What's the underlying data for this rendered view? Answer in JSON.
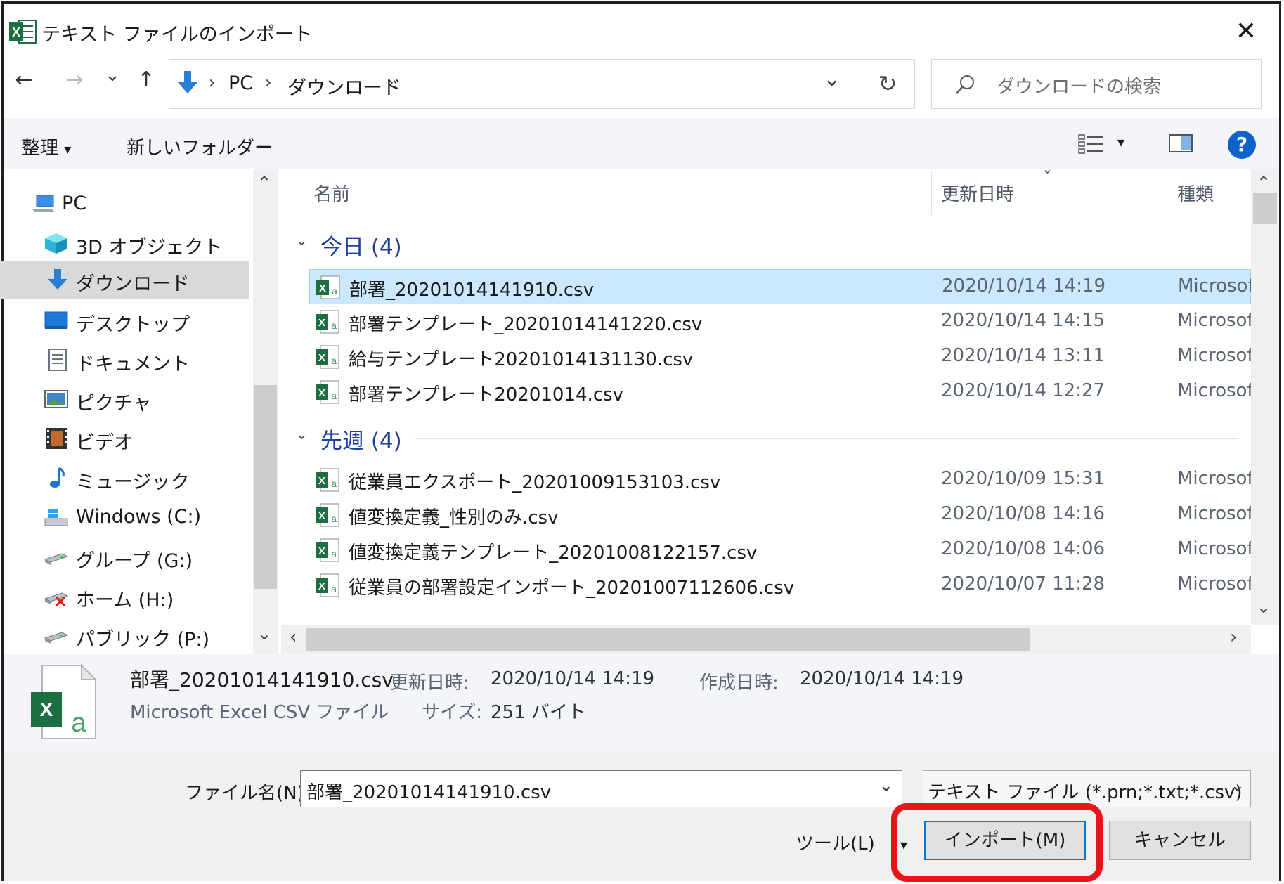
{
  "window": {
    "title": "テキスト ファイルのインポート",
    "close": "✕"
  },
  "address": {
    "back": "←",
    "forward": "→",
    "recent": "⌄",
    "up": "↑",
    "crumbs": [
      "PC",
      "ダウンロード"
    ],
    "separator": "›",
    "dropdown": "⌄",
    "refresh": "↻",
    "search_placeholder": "ダウンロードの検索"
  },
  "commands": {
    "organize": "整理",
    "organize_arrow": "▾",
    "new_folder": "新しいフォルダー",
    "view_arrow": "▾",
    "help": "?"
  },
  "nav": {
    "items": [
      {
        "label": "PC",
        "icon": "pc-icon"
      },
      {
        "label": "3D オブジェクト",
        "icon": "3d-objects-icon"
      },
      {
        "label": "ダウンロード",
        "icon": "download-icon",
        "selected": true
      },
      {
        "label": "デスクトップ",
        "icon": "desktop-icon"
      },
      {
        "label": "ドキュメント",
        "icon": "documents-icon"
      },
      {
        "label": "ピクチャ",
        "icon": "pictures-icon"
      },
      {
        "label": "ビデオ",
        "icon": "video-icon"
      },
      {
        "label": "ミュージック",
        "icon": "music-icon"
      },
      {
        "label": "Windows (C:)",
        "icon": "drive-c-icon"
      },
      {
        "label": "グループ (G:)",
        "icon": "network-drive-icon"
      },
      {
        "label": "ホーム (H:)",
        "icon": "disconnected-drive-icon"
      },
      {
        "label": "パブリック (P:)",
        "icon": "network-drive-icon"
      }
    ],
    "scroll_up": "⌃",
    "scroll_down": "⌄"
  },
  "columns": {
    "name": "名前",
    "date": "更新日時",
    "type": "種類",
    "sort_indicator": "⌄"
  },
  "groups": [
    {
      "label": "今日 (4)",
      "files": [
        {
          "name": "部署_20201014141910.csv",
          "date": "2020/10/14 14:19",
          "type": "Microsoft",
          "selected": true
        },
        {
          "name": "部署テンプレート_20201014141220.csv",
          "date": "2020/10/14 14:15",
          "type": "Microsoft"
        },
        {
          "name": "給与テンプレート20201014131130.csv",
          "date": "2020/10/14 13:11",
          "type": "Microsoft"
        },
        {
          "name": "部署テンプレート20201014.csv",
          "date": "2020/10/14 12:27",
          "type": "Microsoft"
        }
      ]
    },
    {
      "label": "先週 (4)",
      "files": [
        {
          "name": "従業員エクスポート_20201009153103.csv",
          "date": "2020/10/09 15:31",
          "type": "Microsoft"
        },
        {
          "name": "値変換定義_性別のみ.csv",
          "date": "2020/10/08 14:16",
          "type": "Microsoft"
        },
        {
          "name": "値変換定義テンプレート_20201008122157.csv",
          "date": "2020/10/08 14:06",
          "type": "Microsoft"
        },
        {
          "name": "従業員の部署設定インポート_20201007112606.csv",
          "date": "2020/10/07 11:28",
          "type": "Microsoft"
        }
      ]
    }
  ],
  "details": {
    "file_name": "部署_20201014141910.csv",
    "file_type": "Microsoft Excel CSV ファイル",
    "modified_label": "更新日時:",
    "modified_value": "2020/10/14 14:19",
    "created_label": "作成日時:",
    "created_value": "2020/10/14 14:19",
    "size_label": "サイズ:",
    "size_value": "251 バイト"
  },
  "footer": {
    "filename_label": "ファイル名(N):",
    "filename_value": "部署_20201014141910.csv",
    "filter_value": "テキスト ファイル (*.prn;*.txt;*.csv)",
    "tools_label": "ツール(L)",
    "import_button": "インポート(M)",
    "cancel_button": "キャンセル"
  },
  "colors": {
    "accent": "#0078d7",
    "selection": "#cce8ff",
    "highlight_annotation": "#e8141a",
    "excel_green": "#1d6f42"
  }
}
